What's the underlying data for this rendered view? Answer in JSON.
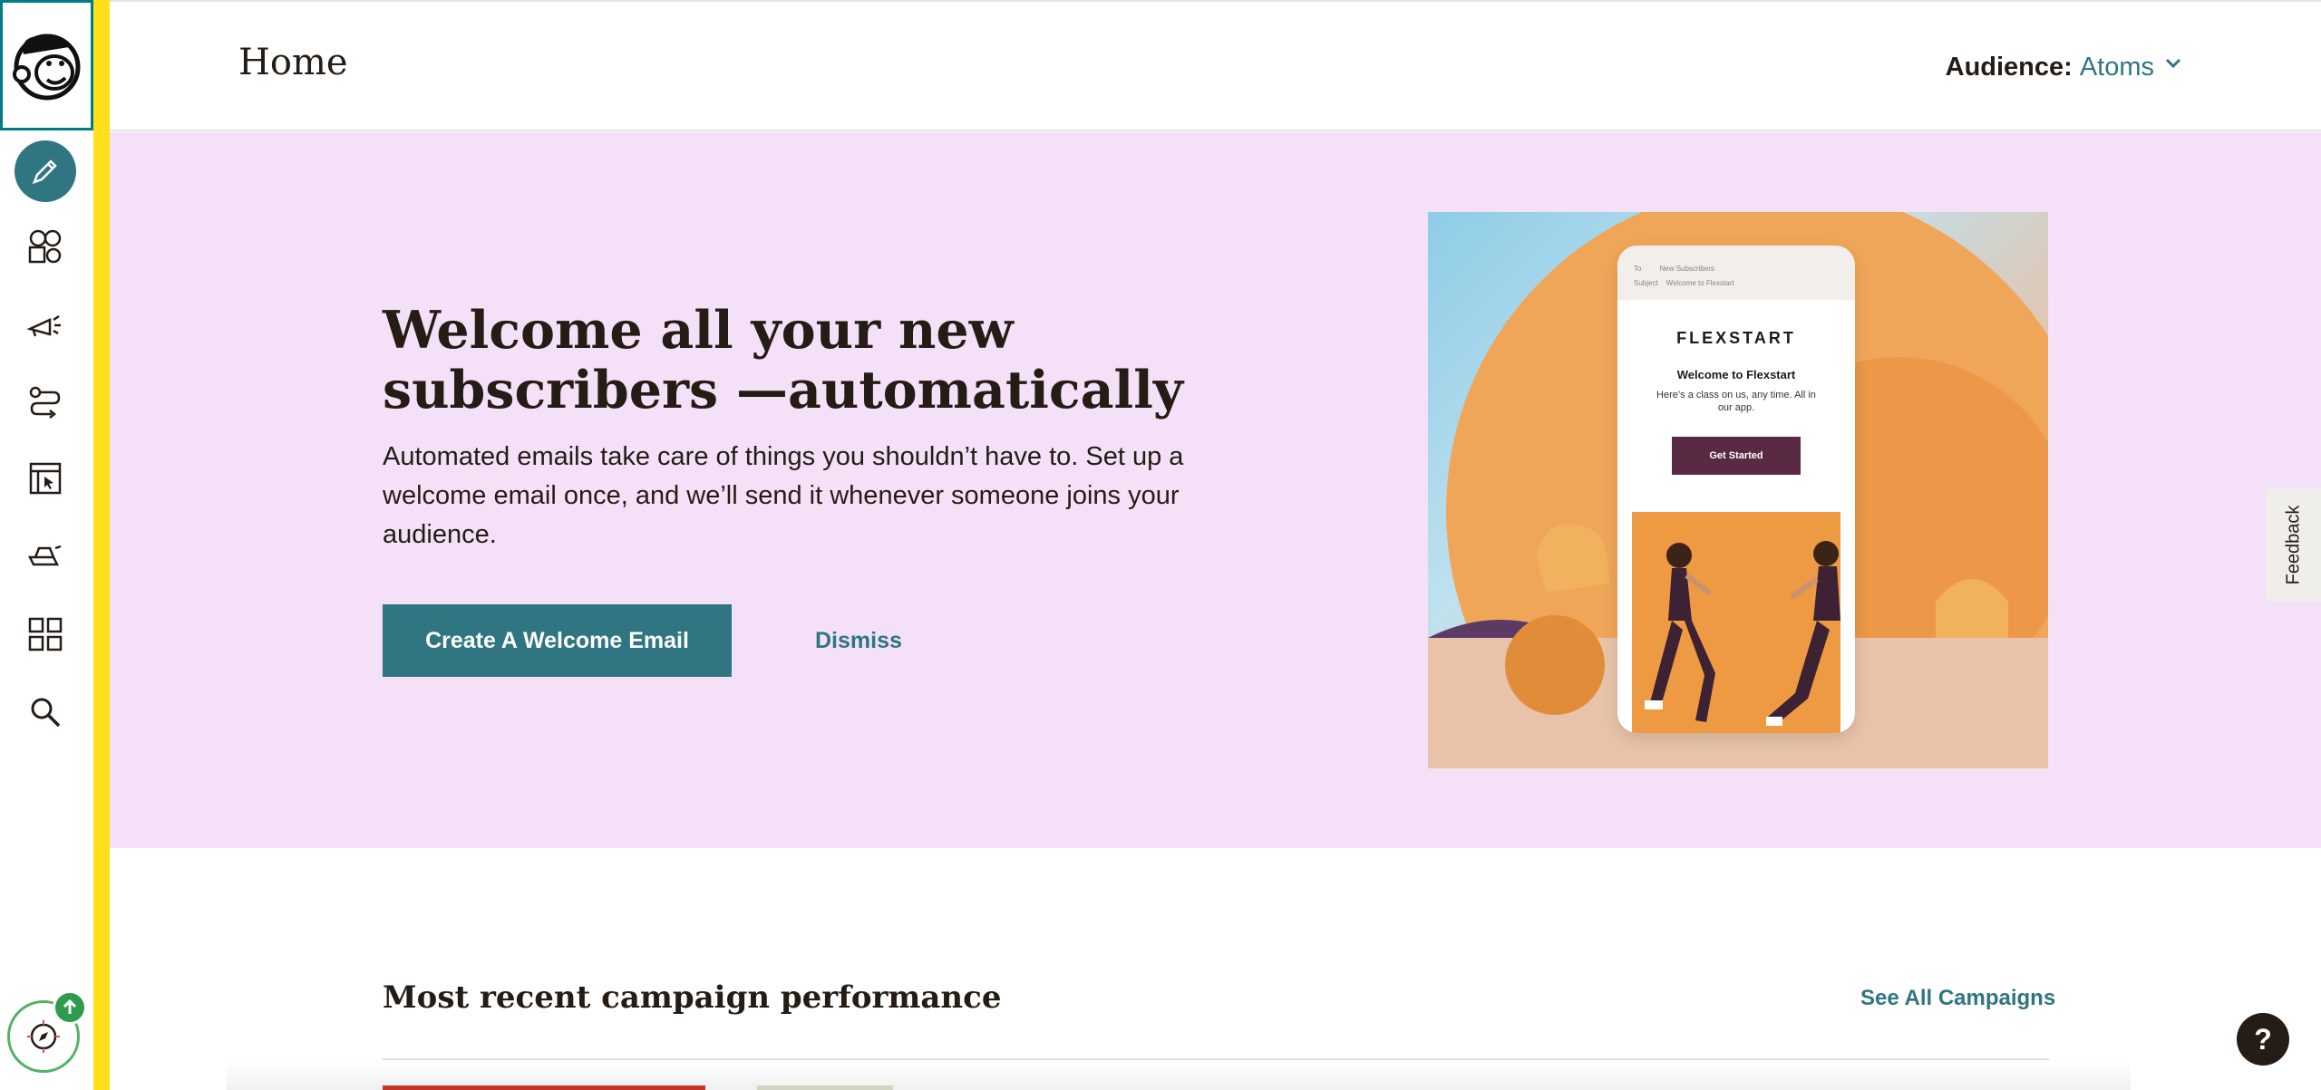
{
  "app": {
    "accent": "#2f7582",
    "rail_stripe": "#ffe01b",
    "hero_bg": "#f4e1f7"
  },
  "rail": {
    "items": [
      {
        "name": "create-icon",
        "active": true
      },
      {
        "name": "audience-icon"
      },
      {
        "name": "campaigns-icon"
      },
      {
        "name": "automations-icon"
      },
      {
        "name": "website-icon"
      },
      {
        "name": "content-studio-icon"
      },
      {
        "name": "integrations-grid-icon"
      },
      {
        "name": "search-icon"
      }
    ]
  },
  "header": {
    "title": "Home",
    "audience_label": "Audience:",
    "audience_value": "Atoms"
  },
  "hero": {
    "title": "Welcome all your new subscribers —automatically",
    "body": "Automated emails take care of things you shouldn’t have to. Set up a welcome email once, and we’ll send it whenever someone joins your audience.",
    "cta_label": "Create A Welcome Email",
    "dismiss_label": "Dismiss",
    "preview": {
      "to_label": "To",
      "to_value": "New Subscribers",
      "subject_label": "Subject",
      "subject_value": "Welcome to Flexstart",
      "brand": "FLEXSTART",
      "heading": "Welcome to Flexstart",
      "subtext": "Here’s a class on us, any time. All in our app.",
      "button": "Get Started"
    }
  },
  "feedback_label": "Feedback",
  "recent": {
    "title": "Most recent campaign performance",
    "see_all": "See All Campaigns"
  },
  "help_label": "?"
}
